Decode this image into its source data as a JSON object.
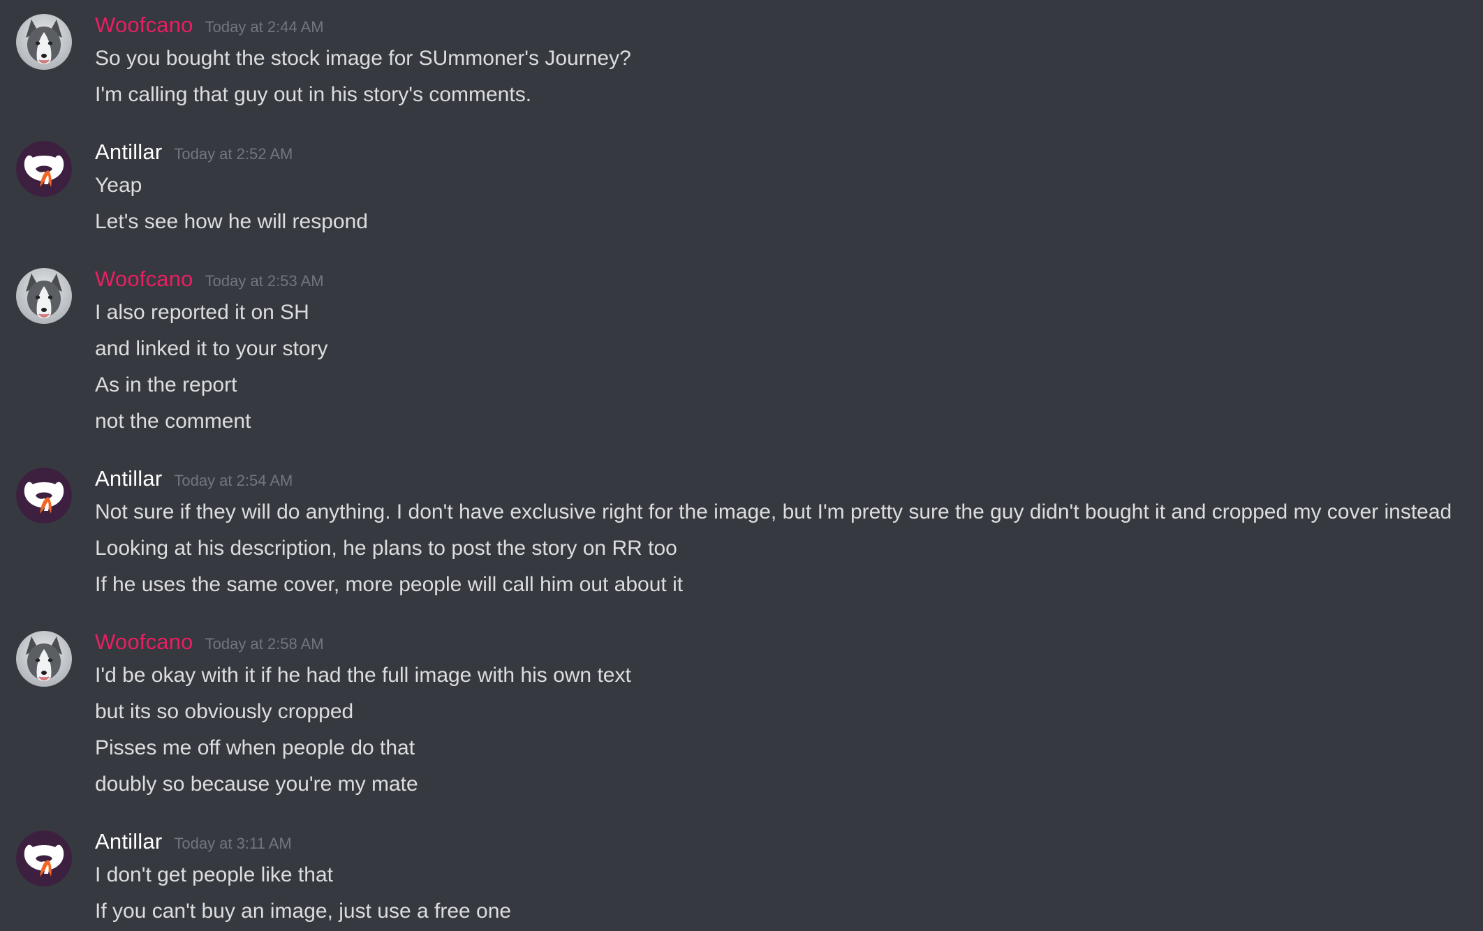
{
  "theme": {
    "background": "#36393f",
    "text": "#dcddde",
    "timestamp": "#72767d",
    "woofcano_color": "#e91e63",
    "antillar_color": "#ffffff",
    "avatar_antillar_bg": "#3d1f40",
    "avatar_antillar_accent": "#f26522"
  },
  "groups": [
    {
      "author": "Woofcano",
      "avatar_icon": "husky-avatar-icon",
      "timestamp": "Today at 2:44 AM",
      "messages": [
        "So you bought the stock image for SUmmoner's Journey?",
        "I'm calling that guy out in his story's comments."
      ]
    },
    {
      "author": "Antillar",
      "avatar_icon": "fox-logo-avatar-icon",
      "timestamp": "Today at 2:52 AM",
      "messages": [
        "Yeap",
        "Let's see how he will respond"
      ]
    },
    {
      "author": "Woofcano",
      "avatar_icon": "husky-avatar-icon",
      "timestamp": "Today at 2:53 AM",
      "messages": [
        "I also reported it on SH",
        "and linked it to your story",
        "As in the report",
        "not the comment"
      ]
    },
    {
      "author": "Antillar",
      "avatar_icon": "fox-logo-avatar-icon",
      "timestamp": "Today at 2:54 AM",
      "messages": [
        "Not sure if they will do anything. I don't have exclusive right for the image, but I'm pretty sure the guy didn't bought it and cropped my cover instead",
        "Looking at his description, he plans to post the story on RR too",
        "If he uses the same cover, more people will call him out about it"
      ]
    },
    {
      "author": "Woofcano",
      "avatar_icon": "husky-avatar-icon",
      "timestamp": "Today at 2:58 AM",
      "messages": [
        "I'd be okay with it if he had the full image with his own text",
        "but its so obviously cropped",
        "Pisses me off when people do that",
        "doubly so because you're my mate"
      ]
    },
    {
      "author": "Antillar",
      "avatar_icon": "fox-logo-avatar-icon",
      "timestamp": "Today at 3:11 AM",
      "messages": [
        "I don't get people like that",
        "If you can't buy an image, just use a free one"
      ]
    }
  ]
}
